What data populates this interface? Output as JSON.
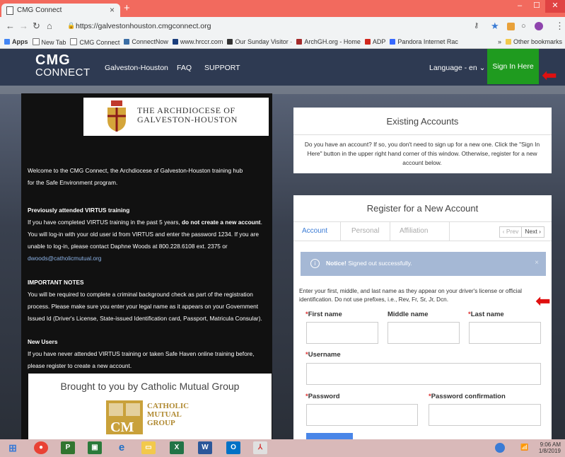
{
  "browser": {
    "tab_title": "CMG Connect",
    "tab_close": "×",
    "new_tab": "+",
    "url": "https://galvestonhouston.cmgconnect.org",
    "bookmarks": [
      "Apps",
      "New Tab",
      "CMG Connect",
      "ConnectNow",
      "www.hrccr.com",
      "Our Sunday Visitor ·",
      "ArchGH.org - Home",
      "ADP",
      "Pandora Internet Rac"
    ],
    "bookmarks_more": "»",
    "other_bookmarks": "Other bookmarks"
  },
  "header": {
    "logo_line1": "CMG",
    "logo_line2": "CONNECT",
    "nav": [
      "Galveston-Houston",
      "FAQ",
      "SUPPORT"
    ],
    "language": "Language - en ⌄",
    "sign_in": "Sign In Here"
  },
  "left": {
    "arch_line1": "THE ARCHDIOCESE OF",
    "arch_line2": "GALVESTON-HOUSTON",
    "welcome_1": "Welcome to the CMG Connect, the Archdiocese of Galveston-Houston training hub",
    "welcome_2": "for the Safe Environment program.",
    "prev_heading": "Previously attended VIRTUS training",
    "prev_1a": "If you have completed VIRTUS training in the past 5 years, ",
    "prev_1b": "do not create a new account",
    "prev_1c": ".",
    "prev_2": "You will log-in with your old user id from VIRTUS and enter the password 1234. If you are",
    "prev_3": "unable to log-in, please contact Daphne Woods at 800.228.6108 ext. 2375 or",
    "prev_email": "dwoods@catholicmutual.org",
    "notes_heading": "IMPORTANT NOTES",
    "notes_1": "You will be required to complete a criminal background check as part of the registration",
    "notes_2": "process. Please make sure you enter your legal name as it appears on your Government",
    "notes_3": "Issued Id (Driver's License, State-issued Identification card, Passport, Matricula Consular).",
    "new_heading": "New Users",
    "new_1": "If you have never attended VIRTUS training or taken Safe Haven online training before,",
    "new_2": "please register to create a new account.",
    "brought": "Brought to you by Catholic Mutual Group",
    "cm_line1": "CATHOLIC",
    "cm_line2": "MUTUAL",
    "cm_line3": "GROUP"
  },
  "existing": {
    "title": "Existing Accounts",
    "text": "Do you have an account? If so, you don't need to sign up for a new one. Click the \"Sign In Here\" button in the upper right hand corner of this window. Otherwise, register for a new account below."
  },
  "register": {
    "title": "Register for a New Account",
    "steps": [
      "Account",
      "Personal",
      "Affiliation"
    ],
    "prev": "‹ Prev",
    "next": "Next ›",
    "notice_bold": "Notice!",
    "notice_text": "Signed out successfully.",
    "notice_close": "×",
    "instructions": "Enter your first, middle, and last name as they appear on your driver's license or official identification. Do not use prefixes, i.e., Rev, Fr, Sr, Jr, Dcn.",
    "first_name": "First name",
    "middle_name": "Middle name",
    "last_name": "Last name",
    "username": "Username",
    "password": "Password",
    "password_confirm": "Password confirmation",
    "required_mark": "*"
  },
  "taskbar": {
    "time": "9:06 AM",
    "date": "1/8/2019"
  },
  "colors": {
    "header_bg": "#2e3a52",
    "signin_bg": "#1f9b1f",
    "accent": "#3a7bd5",
    "annotation_arrow": "#e01010"
  }
}
